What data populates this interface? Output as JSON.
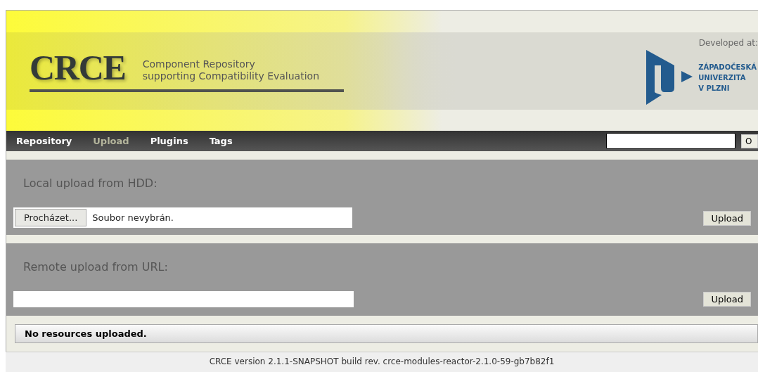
{
  "header": {
    "logo": "CRCE",
    "subtitle_lines": [
      "Component Repository",
      "supporting Compatibility Evaluation"
    ],
    "developed_at": "Developed at:",
    "university_lines": [
      "ZÁPADOČESKÁ",
      "UNIVERZITA",
      "V PLZNI"
    ]
  },
  "nav": {
    "tabs": [
      {
        "label": "Repository",
        "selected": false
      },
      {
        "label": "Upload",
        "selected": true
      },
      {
        "label": "Plugins",
        "selected": false
      },
      {
        "label": "Tags",
        "selected": false
      }
    ],
    "search_button": "O"
  },
  "local_upload": {
    "title": "Local upload from HDD:",
    "browse_button": "Procházet...",
    "file_status": "Soubor nevybrán.",
    "upload_button": "Upload"
  },
  "remote_upload": {
    "title": "Remote upload from URL:",
    "upload_button": "Upload"
  },
  "message": "No resources uploaded.",
  "footer": {
    "lines": [
      "CRCE version 2.1.1-SNAPSHOT build rev. crce-modules-reactor-2.1.0-59-gb7b82f1"
    ]
  }
}
